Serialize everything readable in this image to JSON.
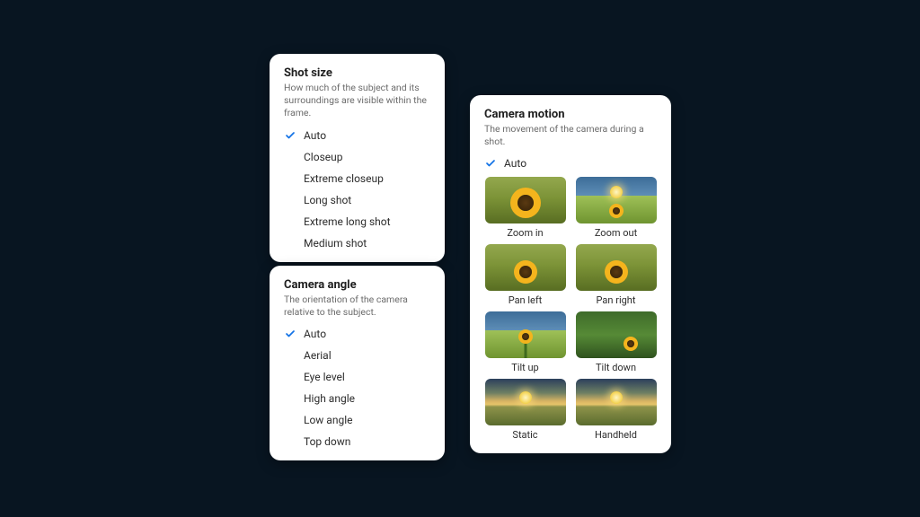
{
  "shot_size": {
    "title": "Shot size",
    "desc": "How much of the subject and its surroundings are visible within the frame.",
    "options": [
      {
        "label": "Auto",
        "selected": true
      },
      {
        "label": "Closeup",
        "selected": false
      },
      {
        "label": "Extreme closeup",
        "selected": false
      },
      {
        "label": "Long shot",
        "selected": false
      },
      {
        "label": "Extreme long shot",
        "selected": false
      },
      {
        "label": "Medium shot",
        "selected": false
      }
    ]
  },
  "camera_angle": {
    "title": "Camera angle",
    "desc": "The orientation of the camera relative to the subject.",
    "options": [
      {
        "label": "Auto",
        "selected": true
      },
      {
        "label": "Aerial",
        "selected": false
      },
      {
        "label": "Eye level",
        "selected": false
      },
      {
        "label": "High angle",
        "selected": false
      },
      {
        "label": "Low angle",
        "selected": false
      },
      {
        "label": "Top down",
        "selected": false
      }
    ]
  },
  "camera_motion": {
    "title": "Camera motion",
    "desc": "The movement of the camera during a shot.",
    "auto_label": "Auto",
    "auto_selected": true,
    "thumbs": [
      {
        "label": "Zoom in",
        "style": "field-big"
      },
      {
        "label": "Zoom out",
        "style": "sky-small"
      },
      {
        "label": "Pan left",
        "style": "field-mid"
      },
      {
        "label": "Pan right",
        "style": "field-mid"
      },
      {
        "label": "Tilt up",
        "style": "sky-stem"
      },
      {
        "label": "Tilt down",
        "style": "grass"
      },
      {
        "label": "Static",
        "style": "sunset"
      },
      {
        "label": "Handheld",
        "style": "sunset"
      }
    ]
  }
}
